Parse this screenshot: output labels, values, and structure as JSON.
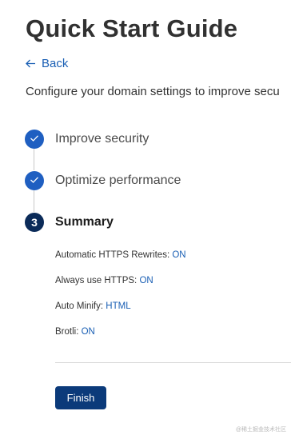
{
  "page": {
    "title": "Quick Start Guide",
    "back_label": "Back",
    "intro": "Configure your domain settings to improve secu"
  },
  "steps": [
    {
      "label": "Improve security",
      "state": "done",
      "marker": "check-icon"
    },
    {
      "label": "Optimize performance",
      "state": "done",
      "marker": "check-icon"
    },
    {
      "label": "Summary",
      "state": "current",
      "number": "3"
    }
  ],
  "summary": [
    {
      "label": "Automatic HTTPS Rewrites:",
      "value": "ON"
    },
    {
      "label": "Always use HTTPS:",
      "value": "ON"
    },
    {
      "label": "Auto Minify:",
      "value": "HTML"
    },
    {
      "label": "Brotli:",
      "value": "ON"
    }
  ],
  "actions": {
    "finish_label": "Finish"
  },
  "watermark": "@稀土掘金技术社区",
  "colors": {
    "accent": "#1f5fc1",
    "link": "#1a5fb4",
    "current_step": "#0b2b59",
    "primary_button": "#0b3a7a"
  }
}
